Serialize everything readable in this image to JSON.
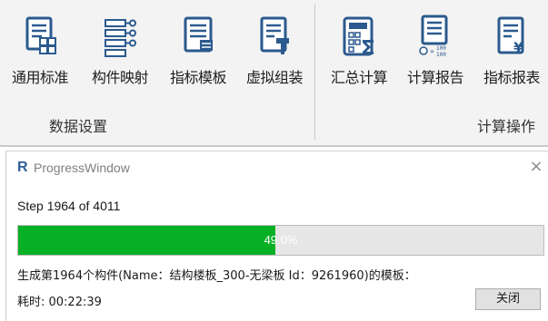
{
  "ribbon": {
    "data_settings": {
      "label": "数据设置",
      "buttons": [
        {
          "label": "通用标准",
          "icon": "document-list-icon"
        },
        {
          "label": "构件映射",
          "icon": "mapping-list-icon"
        },
        {
          "label": "指标模板",
          "icon": "template-document-icon"
        },
        {
          "label": "虚拟组装",
          "icon": "assembly-document-icon"
        }
      ]
    },
    "calc_ops": {
      "label": "计算操作",
      "buttons": [
        {
          "label": "汇总计算",
          "icon": "calculator-sum-icon"
        },
        {
          "label": "计算报告",
          "icon": "report-calc-icon"
        },
        {
          "label": "指标报表",
          "icon": "yen-report-icon"
        }
      ]
    }
  },
  "window": {
    "title": "ProgressWindow",
    "logo": "R",
    "step_text": "Step 1964 of 4011",
    "progress": {
      "percent": 49.0,
      "label": "49.0%"
    },
    "message": "生成第1964个构件(Name：结构楼板_300-无梁板 Id：9261960)的模板：",
    "elapsed": "耗时: 00:22:39",
    "close_label": "关闭",
    "close_glyph": "×"
  },
  "colors": {
    "progress_fill": "#06b025",
    "ribbon_bg": "#f3f3f3",
    "icon_blue": "#2b5a8e"
  }
}
